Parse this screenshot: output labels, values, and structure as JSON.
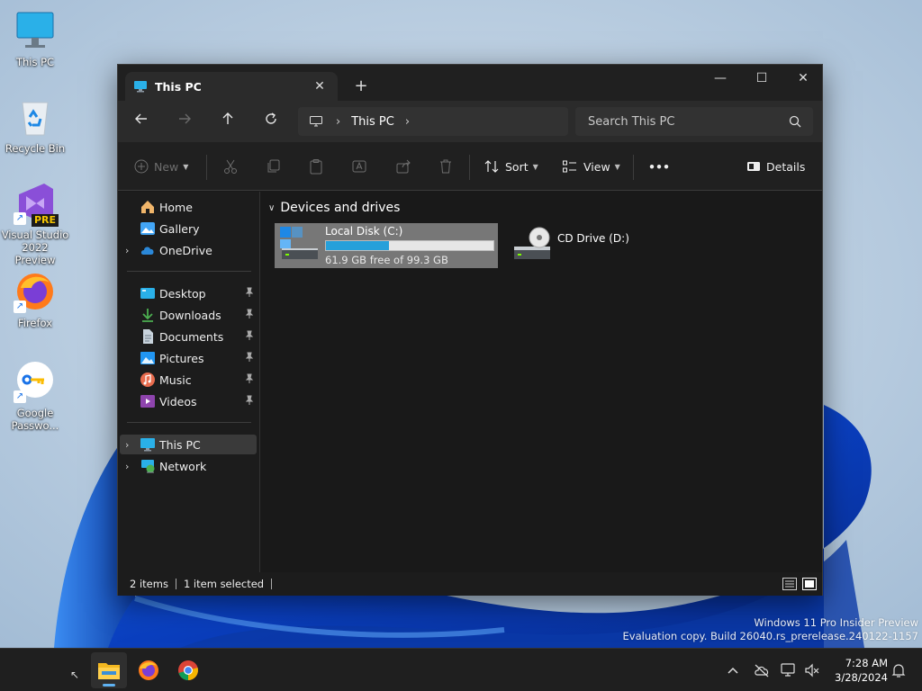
{
  "desktop": {
    "icons": [
      {
        "label": "This PC"
      },
      {
        "label": "Recycle Bin"
      },
      {
        "label": "Visual Studio 2022 Preview",
        "badge": "PRE"
      },
      {
        "label": "Firefox"
      },
      {
        "label": "Google Passwo..."
      }
    ],
    "watermark_line1": "Windows 11 Pro Insider Preview",
    "watermark_line2": "Evaluation copy. Build 26040.rs_prerelease.240122-1157"
  },
  "window": {
    "tab_title": "This PC",
    "tab_close": "✕",
    "new_tab": "+",
    "controls": {
      "minimize": "—",
      "maximize": "☐",
      "close": "✕"
    },
    "address": {
      "crumb": "This PC"
    },
    "search": {
      "placeholder": "Search This PC"
    },
    "toolbar": {
      "new_label": "New",
      "sort_label": "Sort",
      "view_label": "View",
      "more_label": "•••",
      "details_label": "Details"
    },
    "sidebar": {
      "items": [
        {
          "label": "Home"
        },
        {
          "label": "Gallery"
        },
        {
          "label": "OneDrive"
        },
        {
          "label": "Desktop"
        },
        {
          "label": "Downloads"
        },
        {
          "label": "Documents"
        },
        {
          "label": "Pictures"
        },
        {
          "label": "Music"
        },
        {
          "label": "Videos"
        },
        {
          "label": "This PC"
        },
        {
          "label": "Network"
        }
      ]
    },
    "content": {
      "group_title": "Devices and drives",
      "drives": [
        {
          "name": "Local Disk (C:)",
          "free_text": "61.9 GB free of 99.3 GB",
          "used_fraction": 0.377
        },
        {
          "name": "CD Drive (D:)"
        }
      ]
    },
    "status": {
      "items": "2 items",
      "selected": "1 item selected"
    }
  },
  "taskbar": {
    "time": "7:28 AM",
    "date": "3/28/2024"
  },
  "colors": {
    "accent": "#26a0da",
    "window_bg": "#191919",
    "selection": "#777777"
  }
}
